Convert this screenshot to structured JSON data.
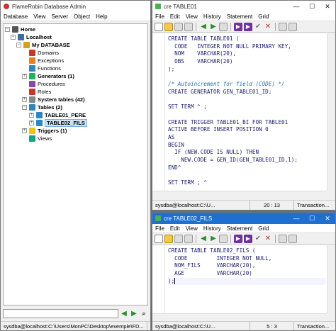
{
  "main": {
    "title": "FlameRobin Database Admin",
    "menu": [
      "Database",
      "View",
      "Server",
      "Object",
      "Help"
    ],
    "tree": {
      "home": "Home",
      "server": "Localhost",
      "database": "My DATABASE",
      "items": [
        "Domains",
        "Exceptions",
        "Functions",
        "Generators (1)",
        "Procedures",
        "Roles",
        "System tables (42)",
        "Tables (2)",
        "TABLE01_PERE",
        "TABLE02_FILS",
        "Triggers (1)",
        "Views"
      ]
    },
    "status": "sysdba@localhost:C:\\Users\\MonPC\\Desktop\\exemple\\FD..."
  },
  "editor1": {
    "title": "cre TABLE01",
    "menu": [
      "File",
      "Edit",
      "View",
      "History",
      "Statement",
      "Grid"
    ],
    "code": [
      "CREATE TABLE TABLE01 (",
      "  CODE   INTEGER NOT NULL PRIMARY KEY,",
      "  NOM    VARCHAR(20),",
      "  OBS    VARCHAR(20)",
      ");",
      "",
      "/* Autoincrement for field (CODE) */",
      "CREATE GENERATOR GEN_TABLE01_ID;",
      "",
      "SET TERM ^ ;",
      "",
      "CREATE TRIGGER TABLE01_BI FOR TABLE01",
      "ACTIVE BEFORE INSERT POSITION 0",
      "AS",
      "BEGIN",
      "  IF (NEW.CODE IS NULL) THEN",
      "    NEW.CODE = GEN_ID(GEN_TABLE01_ID,1);",
      "END^",
      "",
      "SET TERM ; ^"
    ],
    "status": {
      "conn": "sysdba@localhost:C:\\U...",
      "pos": "20 : 13",
      "trans": "Transaction..."
    }
  },
  "editor2": {
    "title": "cre TABLE02_FILS",
    "menu": [
      "File",
      "Edit",
      "View",
      "History",
      "Statement",
      "Grid"
    ],
    "code": [
      "CREATE TABLE TABLE02_FILS (",
      "  CODE         INTEGER NOT NULL,",
      "  NOM_FILS     VARCHAR(20),",
      "  AGE          VARCHAR(20)",
      ");"
    ],
    "status": {
      "conn": "sysdba@localhost:C:\\U...",
      "pos": "5 : 3",
      "trans": "Transaction..."
    }
  },
  "window_controls": {
    "minimize": "—",
    "maximize": "☐",
    "close": "✕"
  }
}
